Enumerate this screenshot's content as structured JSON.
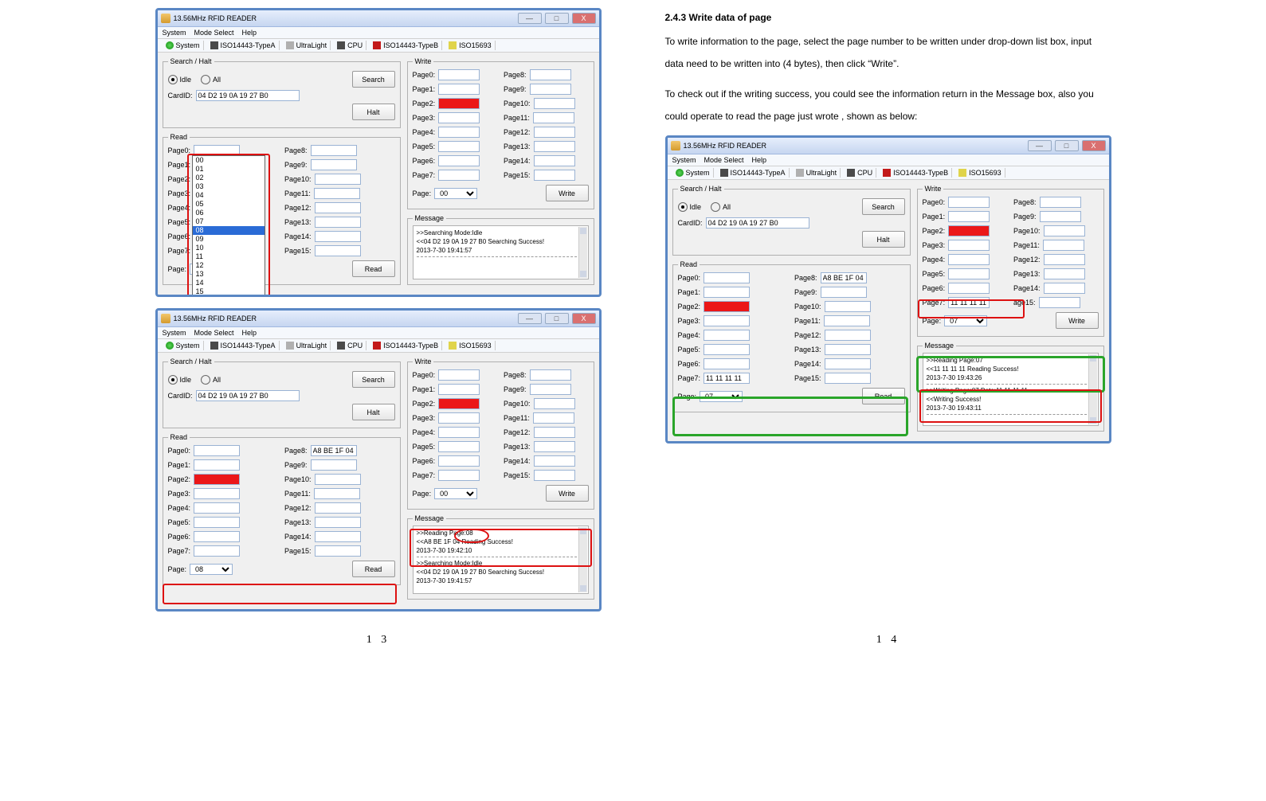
{
  "doc": {
    "left_page_num": "1  3",
    "right_page_num": "1  4",
    "section_title": "2.4.3    Write data of page",
    "para1": "To write information to the page, select the page number to be written under drop-down list box, input data need to be written into (4 bytes), then click “Write”.",
    "para2": "To check out if the writing success, you could see the information return in the Message box, also you could operate to read the page just wrote , shown as below:"
  },
  "window_title": "13.56MHz RFID READER",
  "window_controls": {
    "minimize": "—",
    "maximize": "□",
    "close": "X"
  },
  "menubar": {
    "system": "System",
    "mode_select": "Mode Select",
    "help": "Help"
  },
  "tabs": {
    "system": "System",
    "iso14443a": "ISO14443-TypeA",
    "ultralight": "UltraLight",
    "cpu": "CPU",
    "iso14443b": "ISO14443-TypeB",
    "iso15693": "ISO15693"
  },
  "labels": {
    "search_halt": "Search / Halt",
    "idle": "Idle",
    "all": "All",
    "search": "Search",
    "halt": "Halt",
    "cardid": "CardID:",
    "read_group": "Read",
    "page": "Page:",
    "read_btn": "Read",
    "write_group": "Write",
    "write_btn": "Write",
    "message": "Message",
    "page_label_prefix": "Page"
  },
  "dropdown_options": [
    "00",
    "01",
    "02",
    "03",
    "04",
    "05",
    "06",
    "07",
    "08",
    "09",
    "10",
    "11",
    "12",
    "13",
    "14",
    "15"
  ],
  "ss1": {
    "cardid": "04 D2 19 0A 19 27 B0",
    "read_page_value": "08",
    "write_page_value": "00",
    "msg_line1": ">>Searching    Mode:Idle",
    "msg_line2": "<<04 D2 19 0A 19 27 B0    Searching Success!",
    "msg_line3": "2013-7-30  19:41:57",
    "dropdown_selected": "08"
  },
  "ss2": {
    "cardid": "04 D2 19 0A 19 27 B0",
    "read_page_value": "08",
    "read_page8_value": "A8 BE 1F 04",
    "write_page_value": "00",
    "msg2_line1": ">>Reading    Page:08",
    "msg2_line2": "<<A8 BE 1F 04    Reading Success!",
    "msg2_line3": "2013-7-30  19:42:10",
    "msg2_line4": ">>Searching    Mode:Idle",
    "msg2_line5": "<<04 D2 19 0A 19 27 B0    Searching Success!",
    "msg2_line6": "2013-7-30  19:41:57"
  },
  "ss3": {
    "cardid": "04 D2 19 0A 19 27 B0",
    "read_page_value": "07",
    "read_page7_value": "11 11 11 11",
    "read_page8_value": "A8 BE 1F 04",
    "write_page7_value": "11 11 11 11",
    "write_page_value": "07",
    "msgA_line1": ">>Reading    Page:07",
    "msgA_line2": "<<11 11 11 11    Reading Success!",
    "msgA_line3": "2013-7-30  19:43:26",
    "msgB_line1": ">>Writing    Page:07 Data:11 11 11 11",
    "msgB_line2": "<<Writing Success!",
    "msgB_line3": "2013-7-30  19:43:11"
  }
}
